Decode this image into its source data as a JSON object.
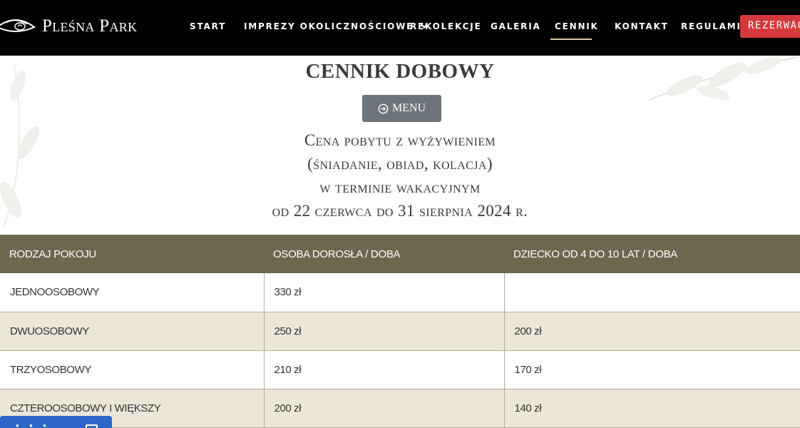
{
  "brand": {
    "name": "Pleśna Park",
    "icon": "eye-logo-icon"
  },
  "nav": {
    "items": [
      {
        "label": "START"
      },
      {
        "label": "IMPREZY OKOLICZNOŚCIOWE",
        "icon": "chevron-down-icon"
      },
      {
        "label": "REKOLEKCJE"
      },
      {
        "label": "GALERIA"
      },
      {
        "label": "CENNIK",
        "active": true
      },
      {
        "label": "KONTAKT"
      },
      {
        "label": "REGULAMIN"
      }
    ],
    "reserve_label": "REZERWACJA"
  },
  "colors": {
    "header_bg": "#000000",
    "accent_red": "#d6393b",
    "table_header_bg": "#6f6650",
    "row_alt_bg": "#ece6d8",
    "menu_button_bg": "#6e747b",
    "chat_widget_bg": "#2a67c9"
  },
  "page": {
    "title": "CENNIK DOBOWY",
    "menu_button": {
      "label": "MENU",
      "icon": "arrow-circle-right-icon"
    },
    "subtitle_lines": [
      "Cena pobytu z wyżywieniem",
      "(śniadanie, obiad, kolacja)",
      "w terminie wakacyjnym",
      "od 22 czerwca do 31 sierpnia 2024 r."
    ]
  },
  "table": {
    "headers": [
      "Rodzaj pokoju",
      "Osoba dorosła / doba",
      "Dziecko od 4 do 10 lat / doba"
    ],
    "rows": [
      [
        "Jednoosobowy",
        "330 zł",
        ""
      ],
      [
        "Dwuosobowy",
        "250 zł",
        "200 zł"
      ],
      [
        "Trzyosobowy",
        "210 zł",
        "170 zł"
      ],
      [
        "Czteroosobowy i większy",
        "200 zł",
        "140 zł"
      ]
    ]
  }
}
